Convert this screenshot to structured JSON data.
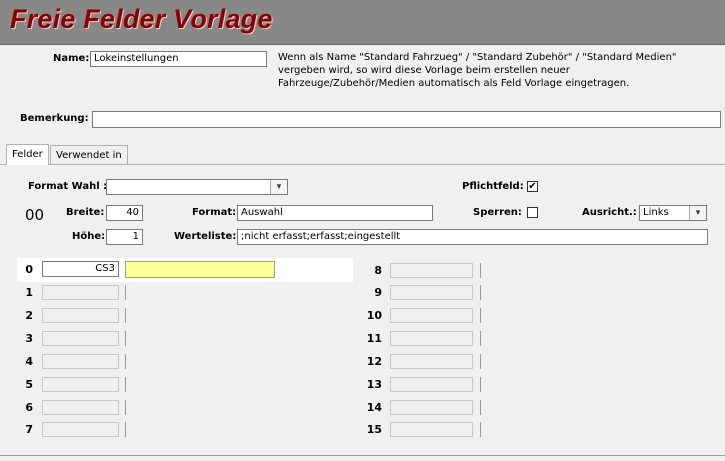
{
  "header": {
    "title": "Freie Felder Vorlage"
  },
  "name": {
    "label": "Name:",
    "value": "Lokeinstellungen",
    "note": "Wenn als Name \"Standard Fahrzueg\" / \"Standard Zubehör\" / \"Standard Medien\" vergeben wird, so wird diese Vorlage beim erstellen neuer Fahrzeuge/Zubehör/Medien automatisch als Feld Vorlage eingetragen."
  },
  "bemerkung": {
    "label": "Bemerkung:",
    "value": ""
  },
  "tabs": [
    {
      "label": "Felder"
    },
    {
      "label": "Verwendet in"
    }
  ],
  "settings": {
    "format_wahl_label": "Format Wahl :",
    "format_wahl_value": "",
    "pflichtfeld_label": "Pflichtfeld:",
    "pflichtfeld_checked": "✔",
    "index": "00",
    "breite_label": "Breite:",
    "breite_value": "40",
    "format_label": "Format:",
    "format_value": "Auswahl",
    "sperren_label": "Sperren:",
    "sperren_checked": "",
    "ausricht_label": "Ausricht.:",
    "ausricht_value": "Links",
    "hoehe_label": "Höhe:",
    "hoehe_value": "1",
    "werteliste_label": "Werteliste:",
    "werteliste_value": ";nicht erfasst;erfasst;eingestellt"
  },
  "fields_left": [
    {
      "num": "0",
      "value": "CS3"
    },
    {
      "num": "1",
      "value": ""
    },
    {
      "num": "2",
      "value": ""
    },
    {
      "num": "3",
      "value": ""
    },
    {
      "num": "4",
      "value": ""
    },
    {
      "num": "5",
      "value": ""
    },
    {
      "num": "6",
      "value": ""
    },
    {
      "num": "7",
      "value": ""
    }
  ],
  "fields_right": [
    {
      "num": "8",
      "value": ""
    },
    {
      "num": "9",
      "value": ""
    },
    {
      "num": "10",
      "value": ""
    },
    {
      "num": "11",
      "value": ""
    },
    {
      "num": "12",
      "value": ""
    },
    {
      "num": "13",
      "value": ""
    },
    {
      "num": "14",
      "value": ""
    },
    {
      "num": "15",
      "value": ""
    }
  ],
  "colors": {
    "header_bg": "#888888",
    "title": "#8b0000",
    "highlight": "#ffff99"
  }
}
